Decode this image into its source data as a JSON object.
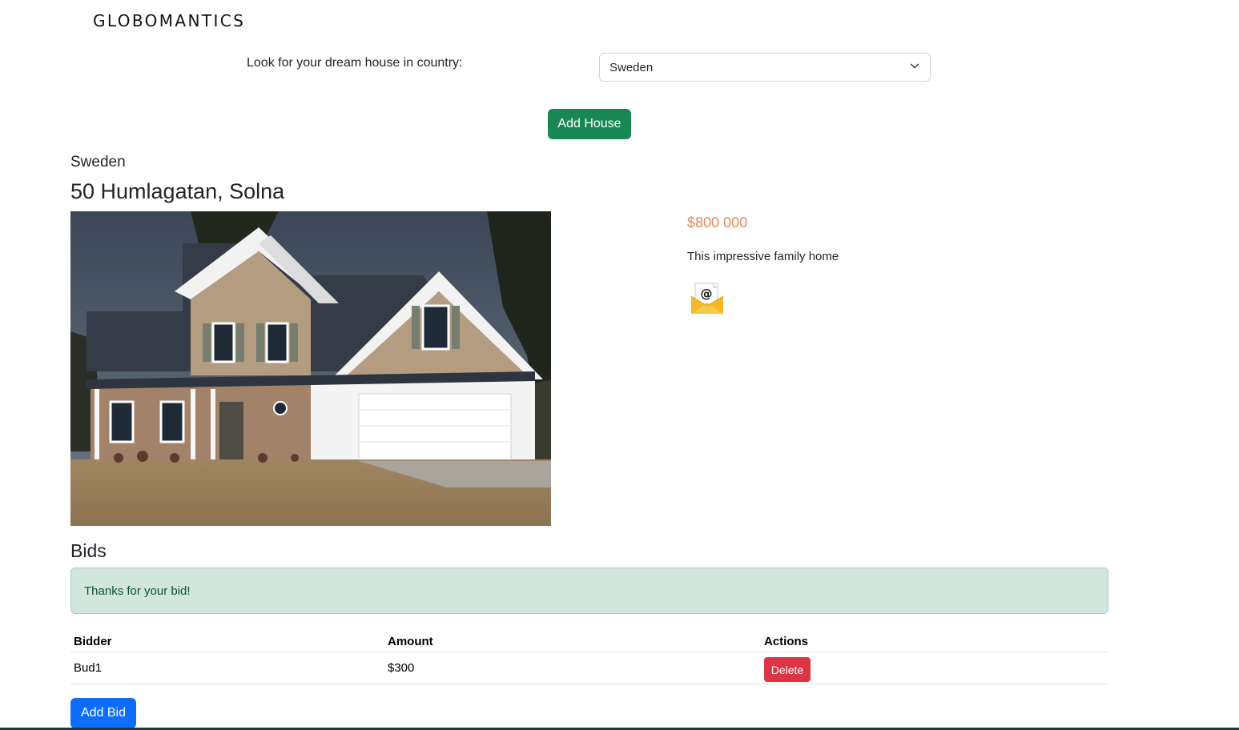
{
  "header": {
    "brand": "GLOBOMANTICS"
  },
  "search": {
    "label": "Look for your dream house in country:",
    "selected_country": "Sweden"
  },
  "actions": {
    "add_house_label": "Add House"
  },
  "house": {
    "country": "Sweden",
    "address": "50 Humlagatan, Solna",
    "price": "$800 000",
    "description": "This impressive family home",
    "contact_icon": "envelope-at-icon"
  },
  "bids": {
    "heading": "Bids",
    "alert_message": "Thanks for your bid!",
    "columns": [
      "Bidder",
      "Amount",
      "Actions"
    ],
    "rows": [
      {
        "bidder": "Bud1",
        "amount": "$300",
        "action_label": "Delete"
      }
    ],
    "add_bid_label": "Add Bid"
  },
  "colors": {
    "success": "#198754",
    "primary": "#0d6efd",
    "danger": "#dc3545",
    "price": "#e8875a",
    "alert_bg": "#d1e7dd"
  }
}
